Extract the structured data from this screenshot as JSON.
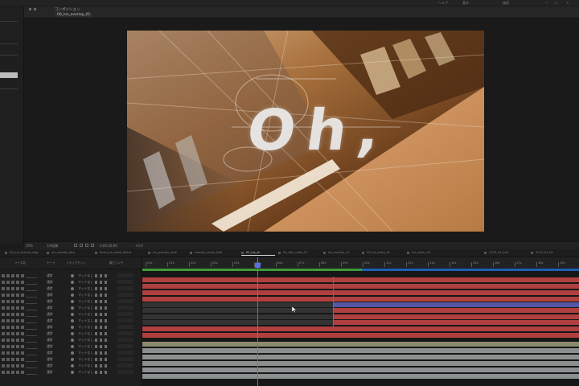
{
  "menu": {
    "items": [
      "ヘルプ",
      "基本",
      "検索"
    ],
    "window_controls": [
      "—",
      "☐",
      "✕"
    ]
  },
  "viewer": {
    "panel_tab": "コンポジション",
    "comp_tab": "00_ins_overlay_01",
    "frame_text": "Oh,",
    "footer": {
      "zoom": "50%",
      "resolution": "1/4画質",
      "timecode": "0;00;00;00",
      "fps": "+0.0"
    }
  },
  "timeline": {
    "tabs": [
      {
        "label": "00_ins_overlay_bkg"
      },
      {
        "label": "ins_overlay_bkg"
      },
      {
        "label": "flash_ins_mask_effect"
      },
      {
        "label": "ins_overlay_fade"
      },
      {
        "label": "overlay_chara_title"
      },
      {
        "label": "02_ins_ch"
      },
      {
        "label": "00_title_main_01"
      },
      {
        "label": "ins_overlay_v2"
      },
      {
        "label": "05_ins_outro_01"
      },
      {
        "label": "ins_main_cut"
      },
      {
        "label": "2023_01_add"
      },
      {
        "label": "2023_01_fin"
      }
    ],
    "active_tab_index": 5,
    "layer_header": {
      "source_name": "ソース名",
      "mode": "モード",
      "track_matte": "トラックマット",
      "parent": "親とリンク"
    },
    "ruler_labels": [
      "00s",
      "01s",
      "02s",
      "03s",
      "04s",
      "05s",
      "06s",
      "07s",
      "08s",
      "09s",
      "10s",
      "11s",
      "12s",
      "13s",
      "14s",
      "15s",
      "16s",
      "17s",
      "18s",
      "19s",
      "20s"
    ],
    "layers": [
      {
        "mode": "通常",
        "matte": "マットなし"
      },
      {
        "mode": "通常",
        "matte": "マットなし"
      },
      {
        "mode": "通常",
        "matte": "マットなし"
      },
      {
        "mode": "通常",
        "matte": "マットなし"
      },
      {
        "mode": "通常",
        "matte": "マットなし"
      },
      {
        "mode": "通常",
        "matte": "マットなし"
      },
      {
        "mode": "通常",
        "matte": "マットなし"
      },
      {
        "mode": "通常",
        "matte": "マットなし"
      },
      {
        "mode": "通常",
        "matte": "マットなし"
      },
      {
        "mode": "通常",
        "matte": "マットなし"
      },
      {
        "mode": "通常",
        "matte": "マットなし"
      },
      {
        "mode": "通常",
        "matte": "マットなし"
      },
      {
        "mode": "通常",
        "matte": "マットなし"
      },
      {
        "mode": "通常",
        "matte": "マットなし"
      },
      {
        "mode": "通常",
        "matte": "マットなし"
      },
      {
        "mode": "通常",
        "matte": "マットなし"
      }
    ],
    "colors": {
      "red_layer": "#b0403f",
      "dark_layer": "#333333",
      "blue_layer": "#5457a8",
      "tan_layer": "#8c8a6e",
      "gray_layer": "#8b8f8f",
      "work_area": "#1a5fb4",
      "playhead": "#5a6fe6"
    }
  }
}
